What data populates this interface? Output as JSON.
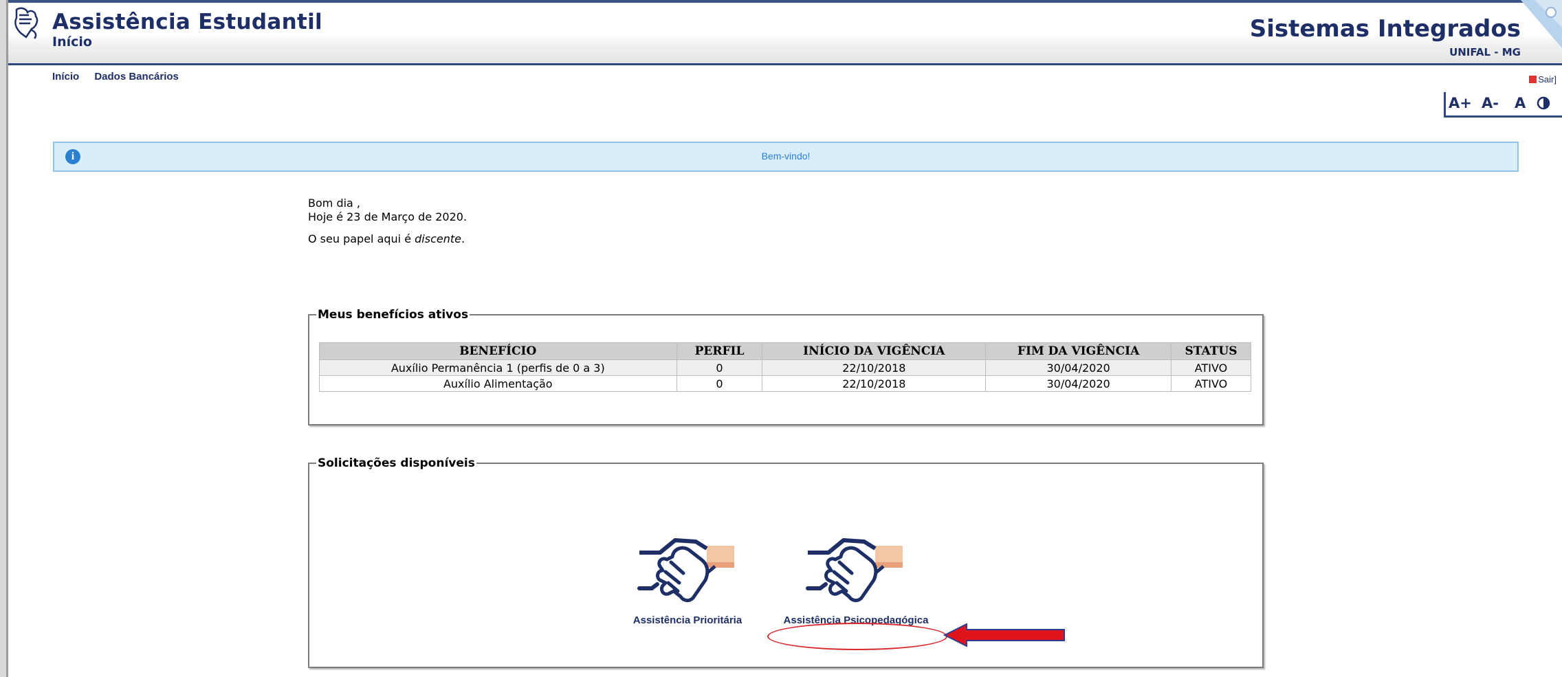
{
  "header": {
    "app_title": "Assistência Estudantil",
    "app_subtitle": "Início",
    "system_title": "Sistemas Integrados",
    "system_subtitle": "UNIFAL - MG",
    "brand_color": "#1d2f66"
  },
  "nav": {
    "items": [
      "Início",
      "Dados Bancários"
    ]
  },
  "tools": {
    "logout_label": "Sair]",
    "font_increase": "A+",
    "font_decrease": "A-",
    "font_reset": "A",
    "contrast_icon": "contrast-icon"
  },
  "info_bar": {
    "message": "Bem-vindo!",
    "icon": "info-icon"
  },
  "greeting": {
    "line1": "Bom dia ,",
    "line2": "Hoje é 23 de Março de 2020.",
    "role_prefix": "O seu papel aqui é ",
    "role_value": "discente",
    "role_suffix": "."
  },
  "benefits": {
    "legend": "Meus benefícios ativos",
    "columns": [
      "BENEFÍCIO",
      "PERFIL",
      "INÍCIO DA VIGÊNCIA",
      "FIM DA VIGÊNCIA",
      "STATUS"
    ],
    "rows": [
      [
        "Auxílio Permanência 1 (perfis de 0 a 3)",
        "0",
        "22/10/2018",
        "30/04/2020",
        "ATIVO"
      ],
      [
        "Auxílio Alimentação",
        "0",
        "22/10/2018",
        "30/04/2020",
        "ATIVO"
      ]
    ]
  },
  "requests": {
    "legend": "Solicitações disponíveis",
    "items": [
      {
        "label": "Assistência Prioritária",
        "icon": "handshake-icon"
      },
      {
        "label": "Assistência Psicopedagógica",
        "icon": "handshake-icon"
      }
    ]
  },
  "annotation": {
    "color": "#e0141b"
  }
}
